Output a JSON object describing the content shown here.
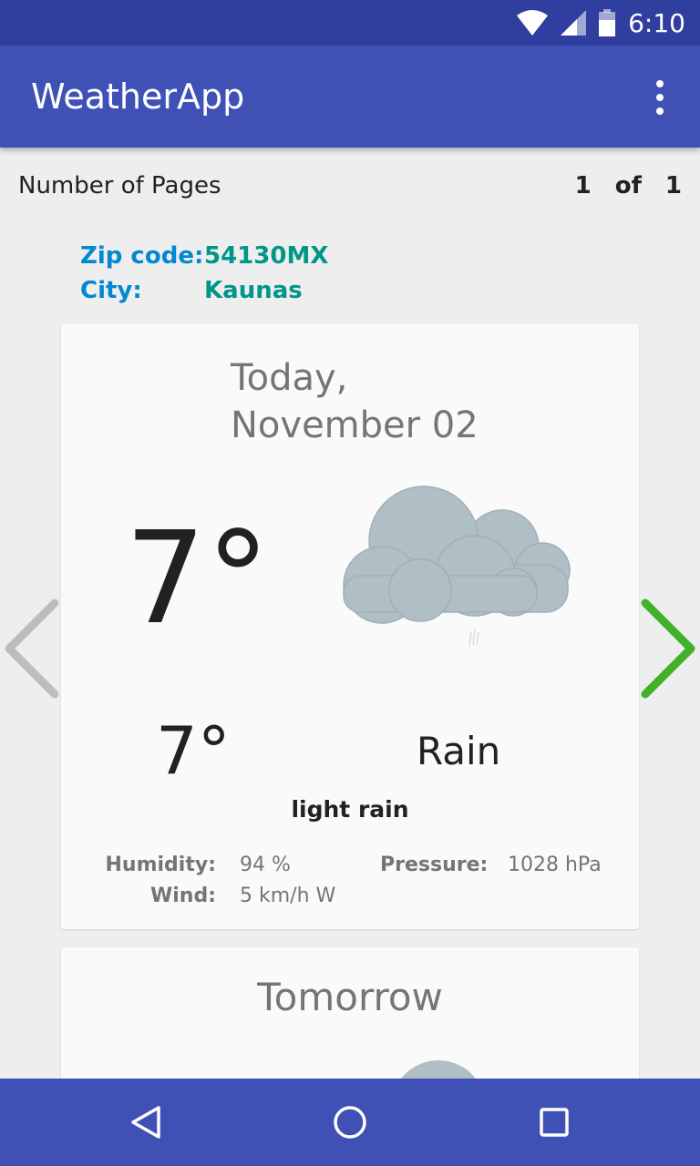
{
  "status_bar": {
    "time": "6:10",
    "icons": [
      "wifi-icon",
      "cell-signal-icon",
      "battery-icon"
    ]
  },
  "app_bar": {
    "title": "WeatherApp",
    "menu_icon": "more-vert-icon"
  },
  "pages": {
    "label": "Number of Pages",
    "current": "1",
    "separator": "of",
    "total": "1"
  },
  "location": {
    "zip_label": "Zip code:",
    "zip_value": "54130MX",
    "city_label": "City:",
    "city_value": "Kaunas"
  },
  "today": {
    "date_line1": "Today,",
    "date_line2": "November 02",
    "temp": "7°",
    "low_temp": "7°",
    "condition": "Rain",
    "description": "light rain",
    "icon": "cloud-rain-icon",
    "humidity_label": "Humidity:",
    "humidity_value": "94 %",
    "wind_label": "Wind:",
    "wind_value": "5 km/h W",
    "pressure_label": "Pressure:",
    "pressure_value": "1028 hPa"
  },
  "tomorrow": {
    "title": "Tomorrow",
    "icon": "cloud-icon"
  },
  "navigation": {
    "prev_icon": "chevron-left-icon",
    "next_icon": "chevron-right-icon",
    "prev_color": "#bdbdbd",
    "next_color": "#43b02a"
  },
  "nav_bar": {
    "back_icon": "back-triangle-icon",
    "home_icon": "home-circle-icon",
    "recents_icon": "recents-square-icon"
  },
  "colors": {
    "primary": "#3f51b5",
    "primary_dark": "#303f9f",
    "label_blue": "#0288d1",
    "value_teal": "#009688",
    "cloud": "#b0bec5"
  }
}
